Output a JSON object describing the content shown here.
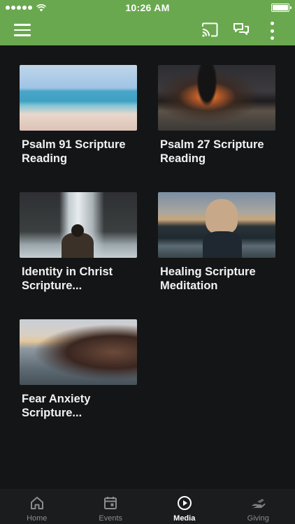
{
  "status_bar": {
    "time": "10:26 AM"
  },
  "app_bar": {
    "icons": [
      "menu-icon",
      "cast-icon",
      "chat-icon",
      "more-vertical-icon"
    ]
  },
  "media": {
    "items": [
      {
        "title": "Psalm 91 Scripture Reading",
        "thumbnail": "beach-ocean"
      },
      {
        "title": "Psalm 27 Scripture Reading",
        "thumbnail": "sunset-shore"
      },
      {
        "title": "Identity in Christ Scripture...",
        "thumbnail": "waterfall-person"
      },
      {
        "title": "Healing Scripture Meditation",
        "thumbnail": "girl-lake"
      },
      {
        "title": "Fear Anxiety Scripture...",
        "thumbnail": "hair-sea"
      }
    ]
  },
  "bottom_nav": {
    "items": [
      {
        "label": "Home",
        "icon": "home-icon",
        "active": false
      },
      {
        "label": "Events",
        "icon": "calendar-icon",
        "active": false
      },
      {
        "label": "Media",
        "icon": "play-circle-icon",
        "active": true
      },
      {
        "label": "Giving",
        "icon": "giving-hand-icon",
        "active": false
      }
    ]
  },
  "colors": {
    "accent": "#6aa84f",
    "background": "#141516",
    "nav_background": "#1b1c1d",
    "nav_inactive": "#8a8c8e",
    "nav_active": "#ffffff"
  }
}
